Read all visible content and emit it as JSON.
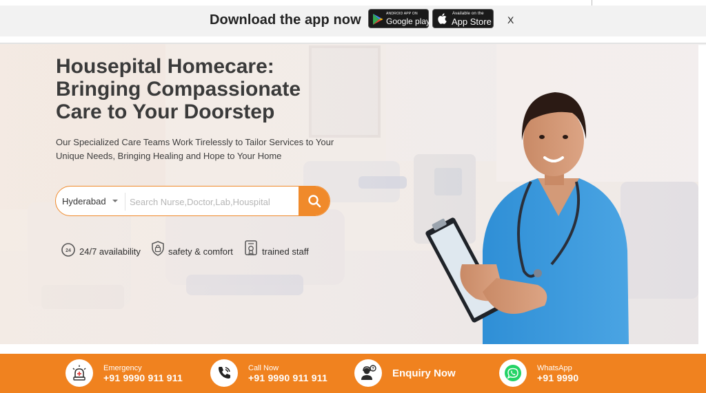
{
  "app_banner": {
    "title": "Download the app now",
    "google_play": {
      "small": "ANDROID APP ON",
      "big": "Google play"
    },
    "app_store": {
      "small": "Available on the",
      "big": "App Store"
    },
    "close_label": "X"
  },
  "hero": {
    "headline_lines": [
      "Housepital Homecare:",
      "Bringing Compassionate",
      "Care to Your Doorstep"
    ],
    "subtitle_lines": [
      "Our Specialized Care Teams Work Tirelessly to Tailor Services to Your",
      "Unique Needs, Bringing Healing and Hope to Your Home"
    ],
    "search": {
      "city": "Hyderabad",
      "placeholder": "Search Nurse,Doctor,Lab,Houspital"
    },
    "features": [
      {
        "icon": "clock-24-icon",
        "label": "24/7 availability"
      },
      {
        "icon": "shield-lock-icon",
        "label": "safety & comfort"
      },
      {
        "icon": "certificate-icon",
        "label": "trained staff"
      }
    ]
  },
  "bottom_bar": {
    "emergency": {
      "label": "Emergency",
      "value": "+91 9990 911 911",
      "icon": "siren-icon"
    },
    "call": {
      "label": "Call Now",
      "value": "+91 9990 911 911",
      "icon": "phone-icon"
    },
    "enquiry": {
      "label": "Enquiry Now",
      "icon": "support-agent-icon"
    },
    "whatsapp": {
      "label": "WhatsApp",
      "value": "+91 9990",
      "icon": "whatsapp-icon"
    }
  },
  "colors": {
    "accent": "#f0821f",
    "banner_bg": "#f2f2f2",
    "text_dark": "#3a3a3a",
    "whatsapp": "#25d366"
  }
}
